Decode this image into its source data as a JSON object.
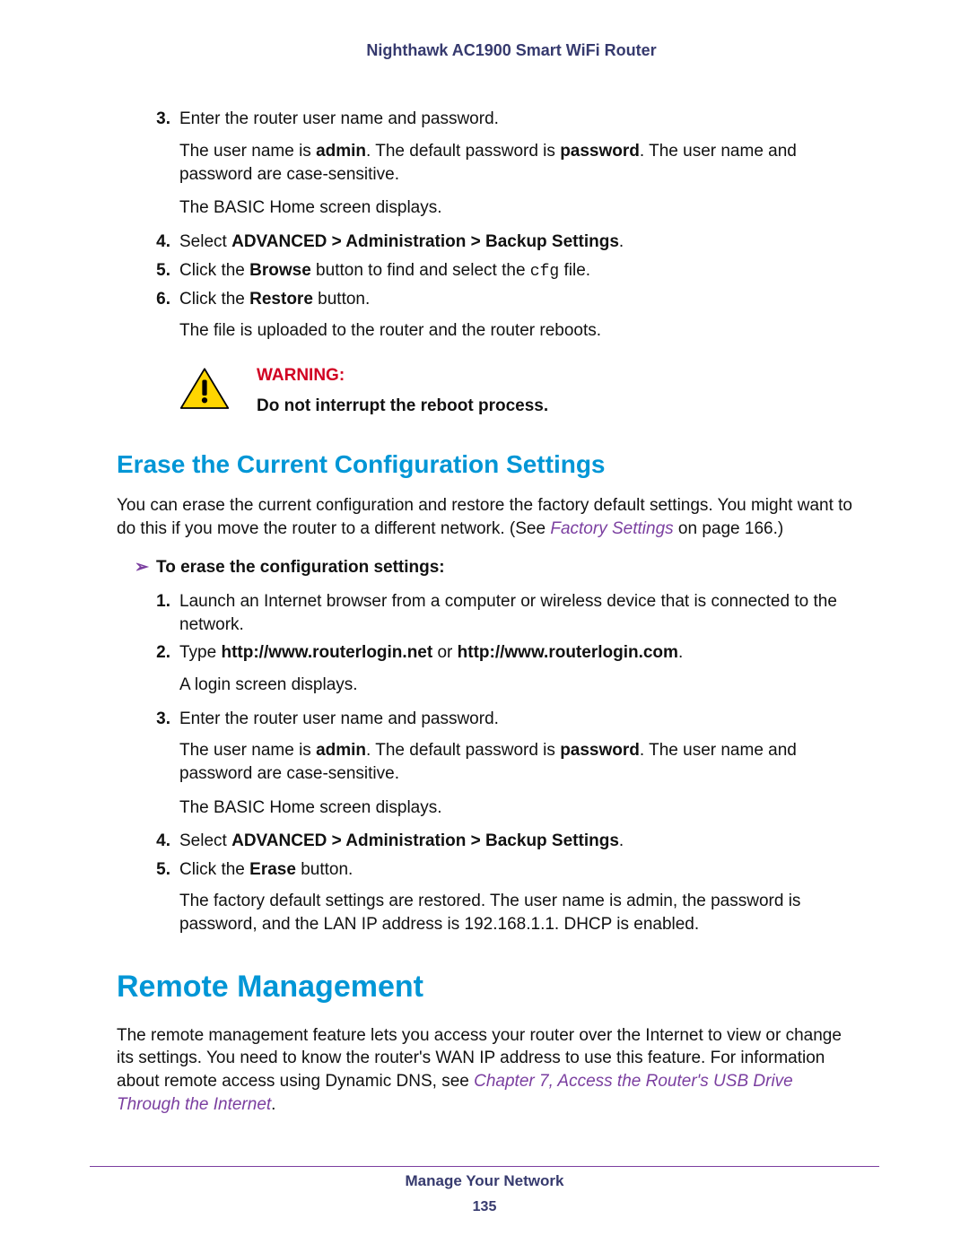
{
  "header": "Nighthawk AC1900 Smart WiFi Router",
  "top_steps": {
    "s3_num": "3.",
    "s3_text": "Enter the router user name and password.",
    "s3_p1a": "The user name is ",
    "s3_b1": "admin",
    "s3_p1b": ". The default password is ",
    "s3_b2": "password",
    "s3_p1c": ". The user name and password are case-sensitive.",
    "s3_p2": "The BASIC Home screen displays.",
    "s4_num": "4.",
    "s4_a": "Select ",
    "s4_b": "ADVANCED > Administration > Backup Settings",
    "s4_c": ".",
    "s5_num": "5.",
    "s5_a": "Click the ",
    "s5_b": "Browse",
    "s5_c": " button to find and select the ",
    "s5_code": "cfg",
    "s5_d": " file.",
    "s6_num": "6.",
    "s6_a": "Click the ",
    "s6_b": "Restore",
    "s6_c": " button.",
    "s6_p1": "The file is uploaded to the router and the router reboots."
  },
  "warning": {
    "label": "WARNING:",
    "text": "Do not interrupt the reboot process."
  },
  "erase": {
    "title": "Erase the Current Configuration Settings",
    "intro_a": "You can erase the current configuration and restore the factory default settings. You might want to do this if you move the router to a different network. (See ",
    "intro_xref": "Factory Settings",
    "intro_b": " on page 166.)",
    "proc_head": "To erase the configuration settings:",
    "s1_num": "1.",
    "s1_text": "Launch an Internet browser from a computer or wireless device that is connected to the network.",
    "s2_num": "2.",
    "s2_a": "Type ",
    "s2_b1": "http://www.routerlogin.net",
    "s2_mid": " or ",
    "s2_b2": "http://www.routerlogin.com",
    "s2_c": ".",
    "s2_p1": "A login screen displays.",
    "s3_num": "3.",
    "s3_text": "Enter the router user name and password.",
    "s3_p1a": "The user name is ",
    "s3_b1": "admin",
    "s3_p1b": ". The default password is ",
    "s3_b2": "password",
    "s3_p1c": ". The user name and password are case-sensitive.",
    "s3_p2": "The BASIC Home screen displays.",
    "s4_num": "4.",
    "s4_a": "Select ",
    "s4_b": "ADVANCED > Administration > Backup Settings",
    "s4_c": ".",
    "s5_num": "5.",
    "s5_a": "Click the ",
    "s5_b": "Erase",
    "s5_c": " button.",
    "s5_p1": "The factory default settings are restored. The user name is admin, the password is password, and the LAN IP address is 192.168.1.1. DHCP is enabled."
  },
  "remote": {
    "title": "Remote Management",
    "p1a": "The remote management feature lets you access your router over the Internet to view or change its settings. You need to know the router's WAN IP address to use this feature. For information about remote access using Dynamic DNS, see ",
    "p1xref": "Chapter 7, Access the Router's USB Drive Through the Internet",
    "p1b": "."
  },
  "footer": {
    "title": "Manage Your Network",
    "page": "135"
  }
}
